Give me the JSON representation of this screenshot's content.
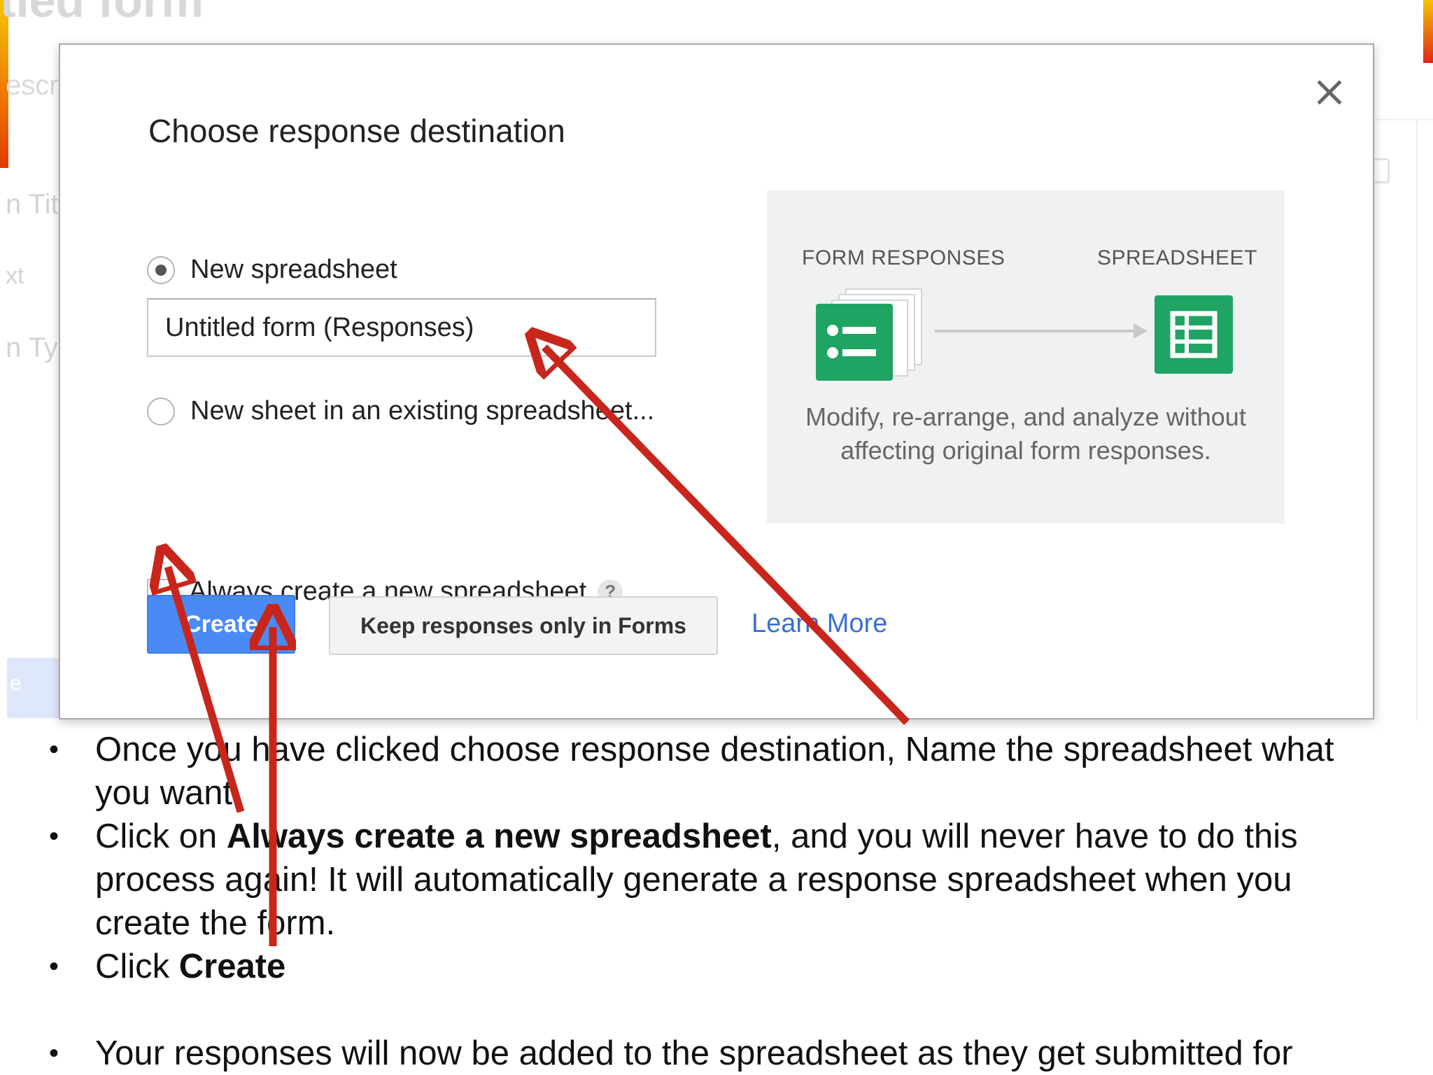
{
  "background": {
    "form_title_partial": "tled form",
    "description_partial": "escri",
    "field_partial_1": "n Tit",
    "field_partial_2": "xt",
    "field_partial_3": "n Ty"
  },
  "dialog": {
    "title": "Choose response destination",
    "options": [
      {
        "label": "New spreadsheet",
        "selected": true
      },
      {
        "label": "New sheet in an existing spreadsheet...",
        "selected": false
      }
    ],
    "spreadsheet_name_value": "Untitled form (Responses)",
    "always_create_label": "Always create a new spreadsheet",
    "always_create_checked": false,
    "help_glyph": "?",
    "create_label": "Create",
    "keep_label": "Keep responses only in Forms",
    "learn_more_label": "Learn More",
    "info_panel": {
      "left_label": "FORM RESPONSES",
      "right_label": "SPREADSHEET",
      "description": "Modify, re-arrange, and analyze without affecting original form responses."
    },
    "icons": {
      "close": "close-icon",
      "forms": "google-forms-icon",
      "sheets": "google-sheets-icon"
    },
    "colors": {
      "create_button": "#4a8af4",
      "link": "#3b6fd0",
      "forms_green": "#1fa463",
      "annotation_arrow": "#c8261c"
    }
  },
  "instructions": {
    "b1": "Once you have clicked choose response destination, Name the spreadsheet what you want.",
    "b2_prefix": "Click on ",
    "b2_bold": "Always create a new spreadsheet",
    "b2_suffix": ", and you will never have to do this process again!  It will automatically generate a response spreadsheet when you create the form.",
    "b3_prefix": "Click ",
    "b3_bold": "Create",
    "b4": "Your responses will now be added to the spreadsheet as they get submitted for"
  }
}
